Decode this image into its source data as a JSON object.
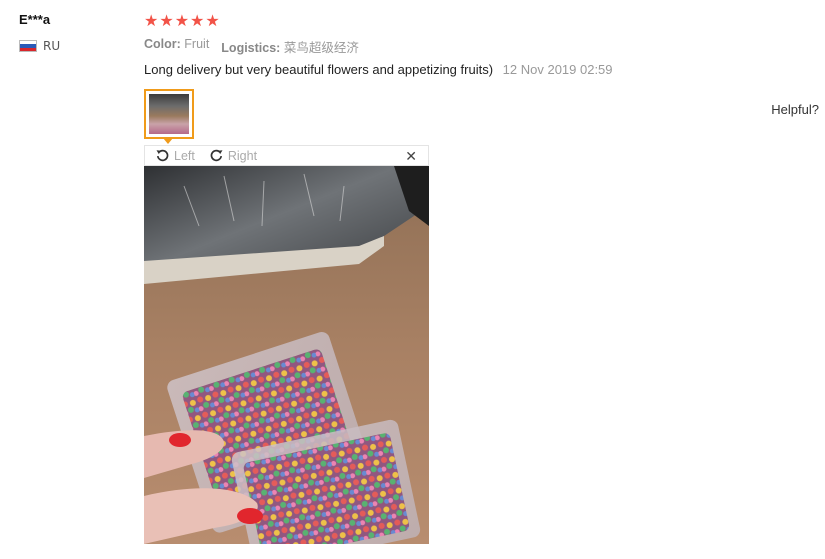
{
  "review": {
    "user_name": "E***a",
    "country": "RU",
    "rating": 5,
    "stars": [
      "★",
      "★",
      "★",
      "★",
      "★"
    ],
    "color_label": "Color:",
    "color_value": "Fruit",
    "logistics_label": "Logistics:",
    "logistics_value": "菜鸟超级经济",
    "text": "Long delivery but very beautiful flowers and appetizing fruits)",
    "date": "12 Nov 2019 02:59",
    "helpful_label": "Helpful?"
  },
  "viewer": {
    "rotate_left_label": "Left",
    "rotate_right_label": "Right",
    "close_symbol": "✕"
  },
  "colors": {
    "star": "#f25348",
    "thumb_border": "#f09b1a",
    "muted_text": "#999999"
  },
  "icons": {
    "rotate_left": "rotate-left-icon",
    "rotate_right": "rotate-right-icon",
    "close": "close-icon",
    "flag": "russia-flag-icon"
  }
}
